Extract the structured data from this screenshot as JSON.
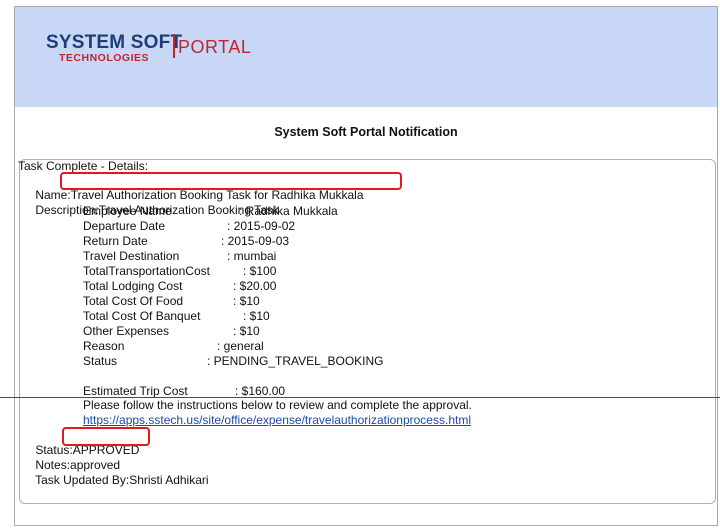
{
  "logo": {
    "main": "SYSTEM SOFT",
    "sub": "TECHNOLOGIES",
    "portal": "PORTAL"
  },
  "page_title": "System Soft Portal Notification",
  "task": {
    "complete_label": "Task Complete - Details:",
    "name_label": "Name:",
    "name_value": "Travel Authorization Booking Task for Radhika Mukkala",
    "description_label": "Description:",
    "description_value": "Travel Authorization Booking Task",
    "details": [
      {
        "label": "Employee Name",
        "value": ": Radhika Mukkala"
      },
      {
        "label": "Departure Date",
        "value": ": 2015-09-02"
      },
      {
        "label": "Return Date",
        "value": ": 2015-09-03"
      },
      {
        "label": "Travel Destination",
        "value": ": mumbai"
      },
      {
        "label": "TotalTransportationCost",
        "value": ": $100"
      },
      {
        "label": "Total Lodging Cost",
        "value": ": $20.00"
      },
      {
        "label": "Total Cost Of Food",
        "value": ": $10"
      },
      {
        "label": "Total Cost Of Banquet",
        "value": ": $10"
      },
      {
        "label": "Other Expenses",
        "value": ": $10"
      },
      {
        "label": "Reason",
        "value": ": general"
      },
      {
        "label": "Status",
        "value": ": PENDING_TRAVEL_BOOKING"
      },
      {
        "label": "Estimated Trip Cost",
        "value": ": $160.00"
      }
    ],
    "instructions": "Please follow the instructions below to review and complete the approval.",
    "link": "https://apps.sstech.us/site/office/expense/travelauthorizationprocess.html",
    "status_label": "Status:",
    "status_value": "APPROVED",
    "notes_label": "Notes:",
    "notes_value": "approved",
    "updated_by_label": "Task Updated By:",
    "updated_by_value": "Shristi Adhikari"
  },
  "highlight_color": "#e01b1b",
  "header_color": "#c9d7f6",
  "link_color": "#1a4aa8"
}
